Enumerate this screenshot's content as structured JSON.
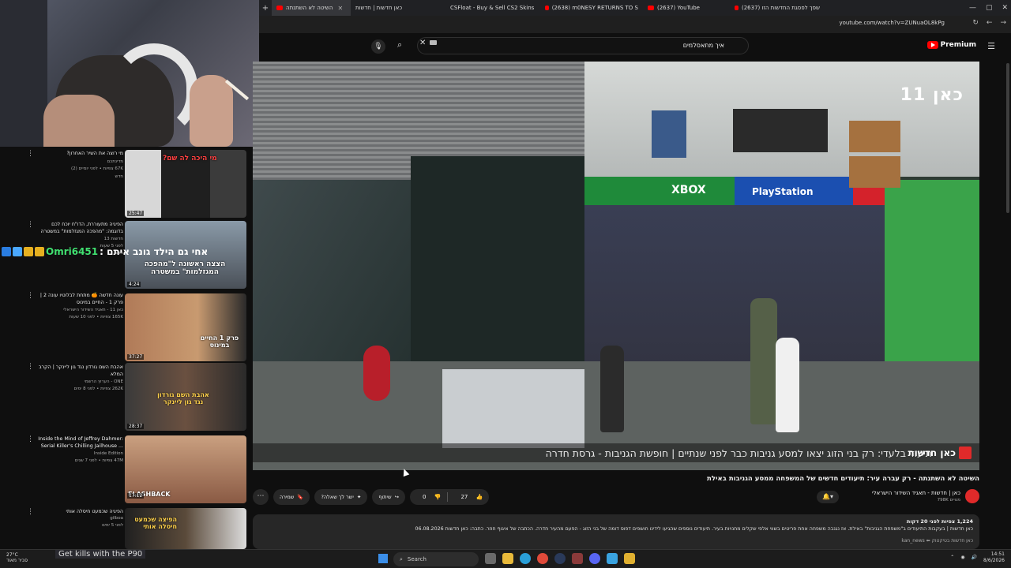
{
  "browser": {
    "new_tab": "+",
    "tabs": [
      {
        "label": "השיטה לא השתנתה",
        "active": true
      },
      {
        "label": "כאן חדשות | חדשות"
      },
      {
        "label": "CSFloat - Buy & Sell CS2 Skins"
      },
      {
        "label": "(2638) m0NESY RETURNS TO S"
      },
      {
        "label": "(2637) YouTube"
      },
      {
        "label": "(2637) שפך לפסגת החדשות הזו"
      }
    ],
    "url": "youtube.com/watch?v=ZUNuaOL8kPg"
  },
  "youtube": {
    "search_query": "איך מתאסלמים",
    "premium_label": "Premium",
    "video_title": "השיטה לא השתנתה - רק עברה עיר: תיעודים חדשים של המשפחה ממסע הגניבות באילת",
    "channel_name": "כאן | חדשות - תאגיד השידור הישראלי",
    "channel_subs": "798K מנויים",
    "likes": "27",
    "dislikes": "0",
    "actions": {
      "share": "שיתוף",
      "ask": "ישר לך שאלה?",
      "save": "שמירה"
    },
    "description": {
      "stats": "1,224 צפיות  לפני 20 דקות",
      "text": "כאן חדשות | בעקבות התיעודים ב\"משפחת הגניבות\" באילת. אז נגנבה משפחה אחת פריטים בשווי אלפי שקלים מחנויות בעיר. תיעודים נוספים שהגיעו לידינו חושפים דפוס דומה של בני הזוג - הפעם מהעיר חדרה. הכתבה של איגוף חוזר. כתבה: כאן חדשות 06.08.2026",
      "more": "כאן חדשות בטיקטוק ⬅ kan_news"
    }
  },
  "player": {
    "logo": "כאן 11",
    "ticker": "תיעוד בלעדי: רק בני הזוג יצאו למסע גניבות כבר לפני שנתיים  |  חופשת הגניבות - גרסת חדרה",
    "ticker_brand": "כאן חדשות",
    "xbox": "XBOX",
    "playstation": "PlayStation"
  },
  "chat": {
    "username": "Omri6451",
    "message": "אחי גם הילד גונב איתם :"
  },
  "recommendations": [
    {
      "title": "מי רוצה את השיר האחרון?",
      "channel": "מדינתכם",
      "meta": "67K צפיות • לפני יומיים (2)",
      "badge": "חדש",
      "duration": "25:47",
      "thumb_text": "מי היכה לה שם?"
    },
    {
      "title": "הפיגיה מתעוררת, הדו\"ח יוכח לכם בדוגמה: \"מהפכה המגזלמות\" במשטרה",
      "channel": "חדשות 13",
      "meta": "לפני 5 שעות",
      "badge": "חדש",
      "duration": "4:24",
      "thumb_text": "הצצה ראשונה ל\"מהפכה המגזלמות\" במשטרה"
    },
    {
      "title": "עונה חדשה 🍊 מתחת לבלוטיו עונה 2 | פרק 1 - החיים במינוס",
      "channel": "כאן 11 - תאגיד השידור הישראלי",
      "meta": "165K צפיות • לפני 10 שעות",
      "badge": "",
      "duration": "37:27",
      "thumb_text": "פרק 1 החיים במינוס"
    },
    {
      "title": "אהבת השם גורדון נגד גון ליינקר | הקרב המלא",
      "channel": "ONE - הערוץ הרשמי",
      "meta": "262K צפיות • לפני 8 ימים",
      "badge": "",
      "duration": "28:37",
      "thumb_text": "אהבת השם גורדון נגד גון ליינקר"
    },
    {
      "title": "Inside the Mind of Jeffrey Dahmer: Serial Killer's Chilling Jailhouse ...",
      "channel": "Inside Edition",
      "meta": "47M צפיות • לפני 7 שנים",
      "badge": "",
      "duration": "17:12",
      "thumb_text": "FLASHBACK"
    },
    {
      "title": "הפיגיה שכמעט חיסלה אותי",
      "channel": "gilboa",
      "meta": "לפני 5 ימים",
      "badge": "",
      "duration": "",
      "thumb_text": "הפיצה שכמעט חיסלה אותי"
    }
  ],
  "taskbar": {
    "weather": "27°C",
    "weather_sub": "סביר מאוד",
    "subtitle": "Get kills with the P90",
    "search": "Search",
    "time": "14:51",
    "date": "8/6/2026"
  }
}
